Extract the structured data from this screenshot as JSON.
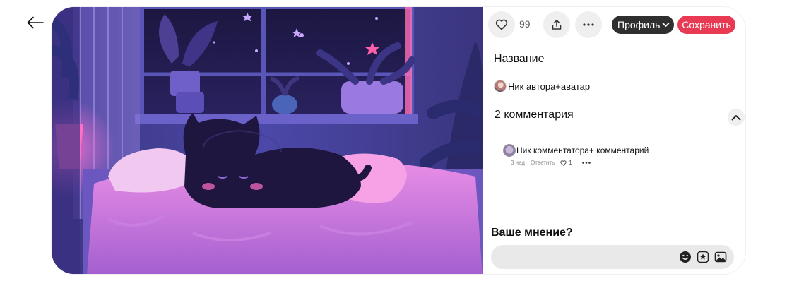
{
  "nav": {
    "back_icon": "arrow-left-icon"
  },
  "pin": {
    "image_description_icon": "pin-artwork",
    "like_count": "99",
    "profile_label": "Профиль",
    "save_label": "Сохранить",
    "title": "Название",
    "author": "Ник автора+аватар"
  },
  "comments": {
    "heading": "2 комментария",
    "items": [
      {
        "text": "Ник комментатора+ комментарий",
        "time": "3 нед",
        "reply_label": "Ответить",
        "likes": "1"
      }
    ]
  },
  "composer": {
    "label": "Ваше мнение?",
    "placeholder": ""
  },
  "colors": {
    "save_button": "#e83a52",
    "profile_button": "#2f2f2f",
    "input_background": "#e9e9e9",
    "button_background": "#efefef"
  },
  "icons": {
    "like": "heart-icon",
    "share": "share-icon",
    "more": "more-dots-icon",
    "chevron": "chevron-down-icon",
    "collapse": "chevron-up-icon",
    "emoji": "emoji-icon",
    "sticker": "sticker-icon",
    "image": "image-icon"
  }
}
